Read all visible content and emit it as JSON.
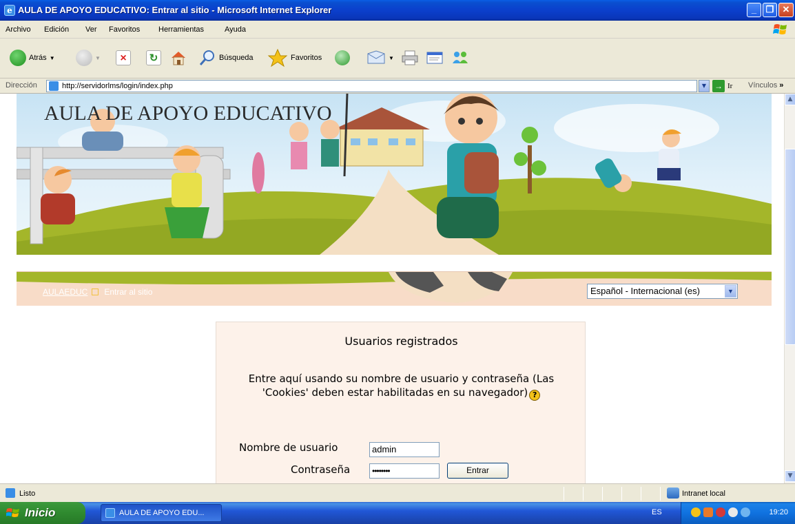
{
  "window": {
    "title": "AULA DE APOYO EDUCATIVO: Entrar al sitio - Microsoft Internet Explorer",
    "min": "_",
    "max": "❐",
    "close": "✕"
  },
  "menu": [
    "Archivo",
    "Edición",
    "Ver",
    "Favoritos",
    "Herramientas",
    "Ayuda"
  ],
  "toolbar": {
    "back": "Atrás",
    "search": "Búsqueda",
    "favorites": "Favoritos"
  },
  "address": {
    "label": "Dirección",
    "url": "http://servidorlms/login/index.php",
    "go": "Ir",
    "links": "Vínculos"
  },
  "page": {
    "banner_title": "AULA DE APOYO EDUCATIVO",
    "breadcrumb_home": "AULAEDUC",
    "breadcrumb_current": "Entrar al sitio",
    "language": "Español - Internacional (es)",
    "login": {
      "heading": "Usuarios registrados",
      "text": "Entre aquí usando su nombre de usuario y contraseña (Las 'Cookies' deben estar habilitadas en su navegador)",
      "username_label": "Nombre de usuario",
      "username_value": "admin",
      "password_label": "Contraseña",
      "password_value": "••••••••",
      "submit": "Entrar"
    }
  },
  "status": {
    "text": "Listo",
    "zone": "Intranet local"
  },
  "taskbar": {
    "start": "Inicio",
    "task": "AULA DE APOYO EDU...",
    "lang": "ES",
    "clock": "19:20"
  },
  "colors": {
    "xp_blue": "#0b3fcc",
    "login_bg": "#fdf2ea",
    "nav_bg": "#f8dcc8",
    "grass": "#a4b62a"
  }
}
